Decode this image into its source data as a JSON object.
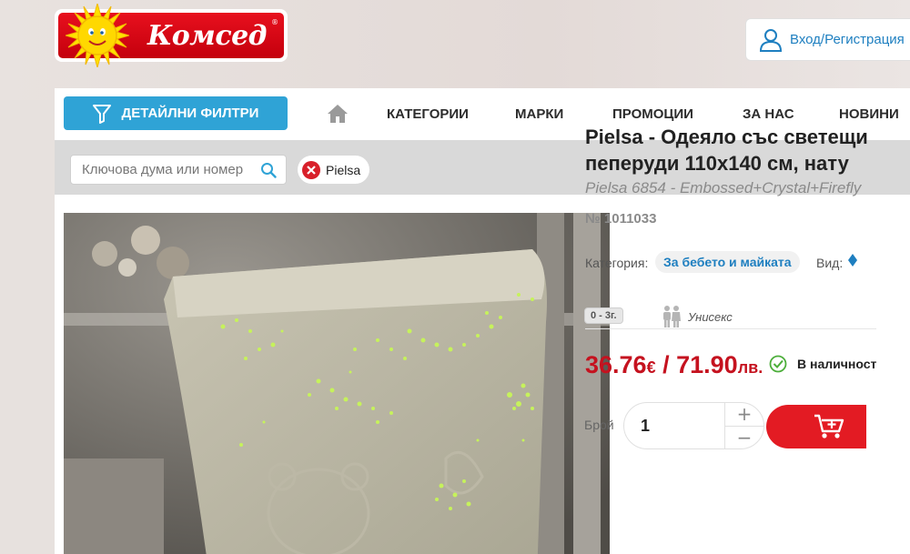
{
  "header": {
    "logo_text": "Комсед",
    "logo_reg": "®",
    "login_label": "Вход/Регистрация"
  },
  "nav": {
    "filter_label": "ДЕТАЙЛНИ ФИЛТРИ",
    "items": [
      "КАТЕГОРИИ",
      "МАРКИ",
      "ПРОМОЦИИ",
      "ЗА НАС",
      "НОВИНИ"
    ]
  },
  "search": {
    "placeholder": "Ключова дума или номер",
    "chip_label": "Pielsa"
  },
  "product": {
    "title_line1": "Pielsa - Одеяло със светещи",
    "title_line2": "пеперуди 110х140 см, нату",
    "subtitle": "Pielsa 6854 - Embossed+Crystal+Firefly",
    "sku": "№ 1011033",
    "category_label": "Категория:",
    "category_value": "За бебето и майката",
    "type_label": "Вид:",
    "age_badge": "0 - 3г.",
    "gender_label": "Унисекс",
    "price_eur": "36.76",
    "currency_eur": "€",
    "price_sep": " / ",
    "price_bgn": "71.90",
    "currency_bgn": "лв.",
    "stock_label": "В наличност",
    "qty_label": "Брой",
    "qty_value": "1",
    "qty_plus": "+",
    "qty_minus": "−"
  },
  "colors": {
    "brand_red": "#e31b23",
    "accent_blue": "#2fa3d6",
    "link_blue": "#1e7fc0",
    "price_red": "#c5121f",
    "stock_green": "#4cae3a"
  },
  "icons": [
    "sun-logo-icon",
    "user-icon",
    "filter-icon",
    "home-icon",
    "search-icon",
    "close-icon",
    "unisex-icon",
    "check-icon",
    "cart-icon"
  ]
}
